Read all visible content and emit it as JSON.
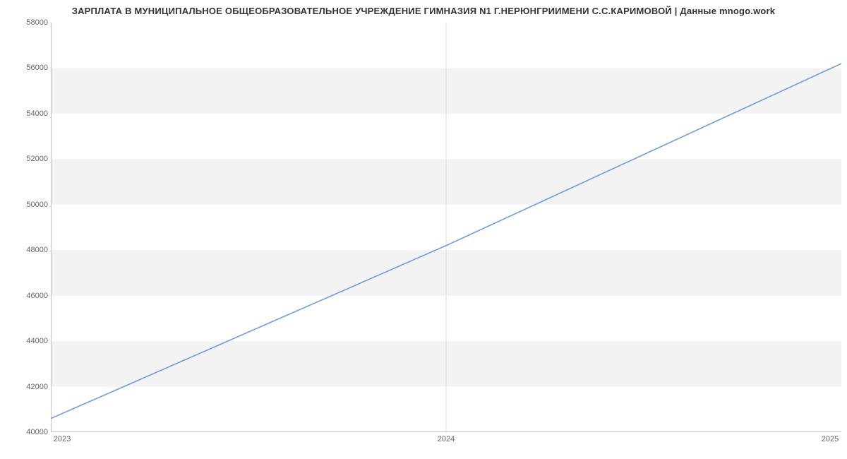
{
  "chart_data": {
    "type": "line",
    "title": "ЗАРПЛАТА В МУНИЦИПАЛЬНОЕ ОБЩЕОБРАЗОВАТЕЛЬНОЕ УЧРЕЖДЕНИЕ ГИМНАЗИЯ N1 Г.НЕРЮНГРИИМЕНИ С.С.КАРИМОВОЙ | Данные mnogo.work",
    "xlabel": "",
    "ylabel": "",
    "xlim": [
      2023,
      2025
    ],
    "ylim": [
      40000,
      58000
    ],
    "y_ticks": [
      40000,
      42000,
      44000,
      46000,
      48000,
      50000,
      52000,
      54000,
      56000,
      58000
    ],
    "x_ticks": [
      2023,
      2024,
      2025
    ],
    "series": [
      {
        "name": "salary",
        "color": "#6f9cde",
        "x": [
          2023,
          2024,
          2025
        ],
        "values": [
          40600,
          48200,
          56200
        ]
      }
    ],
    "banding": true
  },
  "y_tick_labels": {
    "t0": "40000",
    "t1": "42000",
    "t2": "44000",
    "t3": "46000",
    "t4": "48000",
    "t5": "50000",
    "t6": "52000",
    "t7": "54000",
    "t8": "56000",
    "t9": "58000"
  },
  "x_tick_labels": {
    "t0": "2023",
    "t1": "2024",
    "t2": "2025"
  }
}
